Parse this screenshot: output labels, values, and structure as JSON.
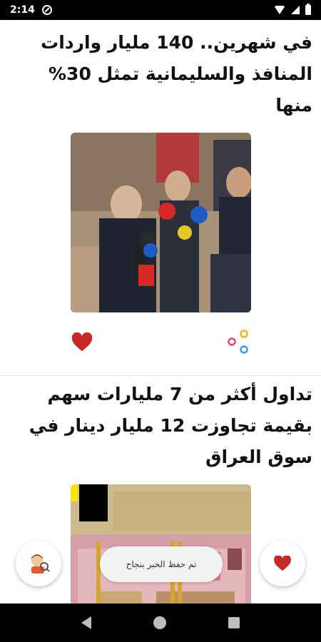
{
  "status_bar": {
    "time": "2:14"
  },
  "articles": [
    {
      "headline": "في شهرين.. 140 مليار واردات المنافذ والسليمانية تمثل 30% منها"
    },
    {
      "headline": "تداول أكثر من 7 مليارات سهم بقيمة تجاوزت 12 مليار دينار في سوق العراق"
    }
  ],
  "toast": {
    "message": "تم حفظ الخبر بنجاح"
  },
  "colors": {
    "accent_red": "#c62828",
    "text_dark": "#111111"
  },
  "icons": {
    "fab_left": "reader-avatar-icon",
    "fab_right": "heart-icon",
    "share": "share-icon"
  }
}
